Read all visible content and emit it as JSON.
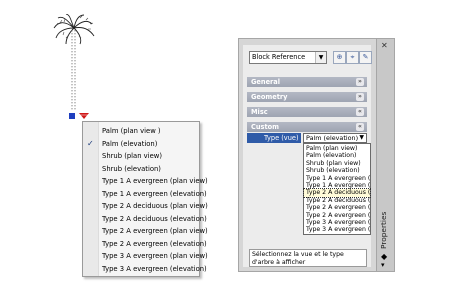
{
  "context_menu": {
    "items": [
      {
        "label": "Palm (plan view )",
        "checked": false
      },
      {
        "label": "Palm (elevation)",
        "checked": true
      },
      {
        "label": "Shrub (plan view)",
        "checked": false
      },
      {
        "label": "Shrub (elevation)",
        "checked": false
      },
      {
        "label": "Type 1 A evergreen (plan view)",
        "checked": false
      },
      {
        "label": "Type 1 A evergreen (elevation)",
        "checked": false
      },
      {
        "label": "Type 2 A deciduous (plan view)",
        "checked": false
      },
      {
        "label": "Type 2 A deciduous (elevation)",
        "checked": false
      },
      {
        "label": "Type 2 A evergreen (plan view)",
        "checked": false
      },
      {
        "label": "Type 2 A evergreen (elevation)",
        "checked": false
      },
      {
        "label": "Type 3 A evergreen (plan view)",
        "checked": false
      },
      {
        "label": "Type 3 A evergreen (elevation)",
        "checked": false
      }
    ],
    "check_glyph": "✓"
  },
  "properties": {
    "selector_value": "Block Reference",
    "toolbar_icons": [
      "toggle-pickadd-icon",
      "select-objects-icon",
      "quick-select-icon"
    ],
    "categories": [
      {
        "label": "General"
      },
      {
        "label": "Geometry"
      },
      {
        "label": "Misc"
      },
      {
        "label": "Custom"
      }
    ],
    "custom_property": {
      "name": "Type (vue)",
      "value": "Palm (elevation)"
    },
    "dropdown_options": [
      "Palm (plan view)",
      "Palm (elevation)",
      "Shrub (plan view)",
      "Shrub (elevation)",
      "Type 1 A evergreen (pla",
      "Type 1 A evergreen (ele",
      "Type 2 A deciduous (plan view)",
      "Type 2 A deciduous (ele",
      "Type 2 A evergreen (pla",
      "Type 2 A evergreen (ele",
      "Type 3 A evergreen (pla",
      "Type 3 A evergreen (ele"
    ],
    "highlighted_option_index": 6,
    "description": "Sélectionnez la vue et le type d'arbre à afficher",
    "palette_title": "Properties"
  },
  "colors": {
    "selection_blue": "#2f5ba8",
    "grip_blue": "#1f3fbf",
    "grip_red": "#d01818"
  }
}
